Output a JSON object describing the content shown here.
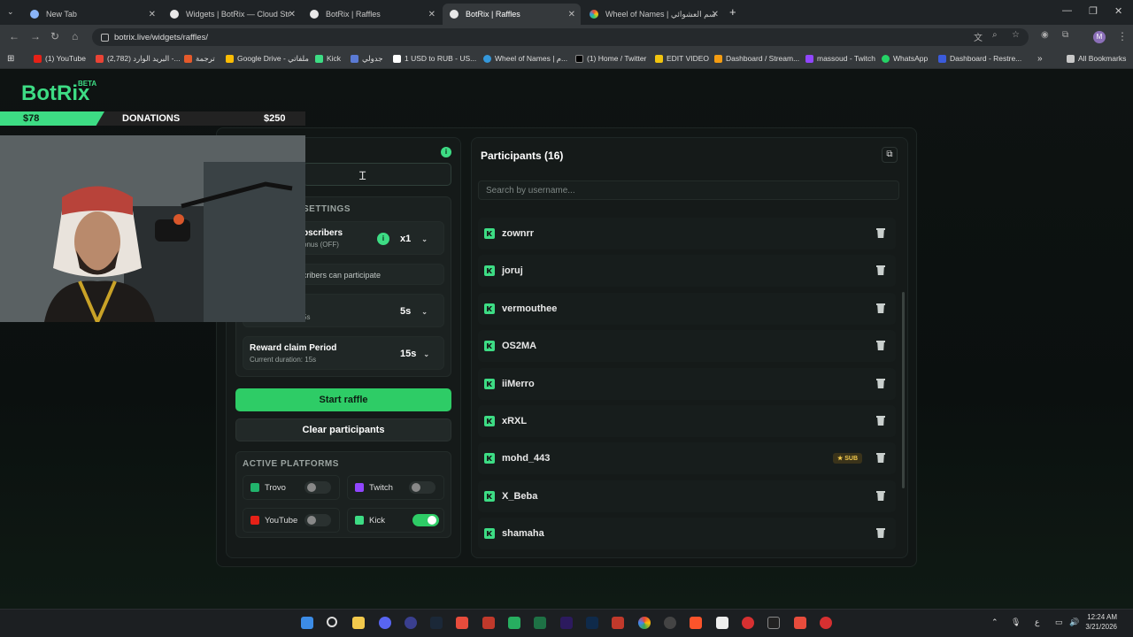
{
  "browser": {
    "tabs": [
      {
        "title": "New Tab",
        "active": false
      },
      {
        "title": "Widgets | BotRix — Cloud Strea",
        "active": false
      },
      {
        "title": "BotRix | Raffles",
        "active": false
      },
      {
        "title": "BotRix | Raffles",
        "active": true
      },
      {
        "title": "Wheel of Names | سم العشوائي",
        "active": false
      }
    ],
    "new_tab_label": "+",
    "url": "botrix.live/widgets/raffles/",
    "bookmarks": [
      "(1) YouTube",
      "(2,782) البريد الوارد -...",
      "ترجمة",
      "Google Drive - ملفاتي",
      "Kick",
      "جدولي",
      "1 USD to RUB - US...",
      "Wheel of Names | م...",
      "(1) Home / Twitter",
      "EDIT VIDEO",
      "Dashboard / Stream...",
      "massoud - Twitch",
      "WhatsApp",
      "Dashboard - Restre..."
    ],
    "all_bookmarks": "All Bookmarks"
  },
  "overlay": {
    "logo": "BotRix",
    "beta": "BETA",
    "donation_current": "$78",
    "donation_label": "DONATIONS",
    "donation_goal": "$250",
    "donation_progress": 0.31
  },
  "settings": {
    "section_title": "SETTINGS",
    "subscribers_title": "bscribers",
    "subscribers_sub": "onus (OFF)",
    "multiplier": "x1",
    "subscribers_note": "cribers can participate",
    "timer_label": "",
    "timer_sub": "5s",
    "timer_value": "5s",
    "reward_title": "Reward claim Period",
    "reward_sub": "Current duration: 15s",
    "reward_value": "15s"
  },
  "actions": {
    "start": "Start raffle",
    "clear": "Clear participants"
  },
  "platforms": {
    "title": "ACTIVE PLATFORMS",
    "items": [
      {
        "name": "Trovo",
        "on": false
      },
      {
        "name": "Twitch",
        "on": false
      },
      {
        "name": "YouTube",
        "on": false
      },
      {
        "name": "Kick",
        "on": true
      }
    ]
  },
  "participants": {
    "title": "Participants (16)",
    "search_placeholder": "Search by username...",
    "sub_badge": "SUB",
    "list": [
      {
        "name": "zownrr",
        "sub": false
      },
      {
        "name": "joruj",
        "sub": false
      },
      {
        "name": "vermouthee",
        "sub": false
      },
      {
        "name": "OS2MA",
        "sub": false
      },
      {
        "name": "iiMerro",
        "sub": false
      },
      {
        "name": "xRXL",
        "sub": false
      },
      {
        "name": "mohd_443",
        "sub": true
      },
      {
        "name": "X_Beba",
        "sub": false
      },
      {
        "name": "shamaha",
        "sub": false
      }
    ]
  },
  "colors": {
    "accent": "#3ddc84",
    "button": "#2ecc66",
    "bg": "#0d1110"
  },
  "system": {
    "time": "12:24 AM",
    "date": "3/21/2026",
    "lang": "ع"
  }
}
